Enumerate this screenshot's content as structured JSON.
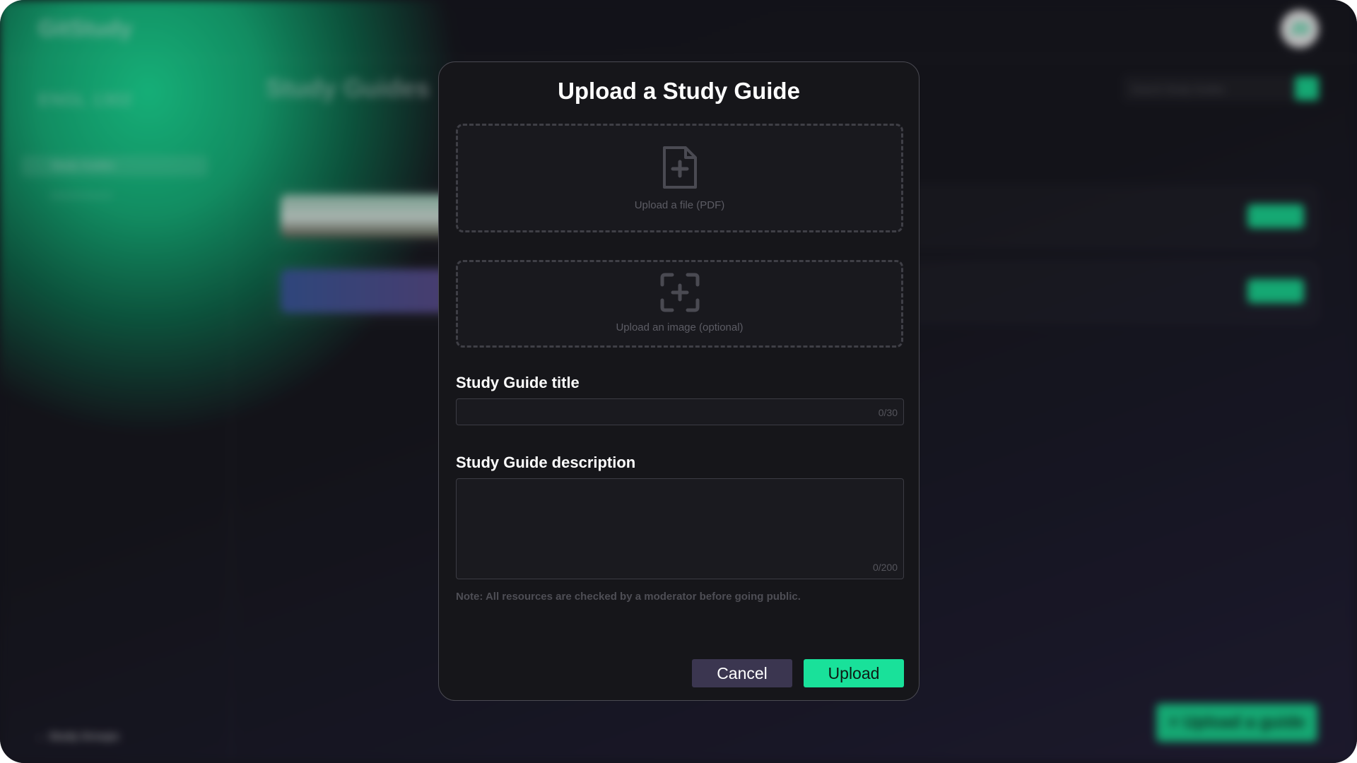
{
  "background": {
    "brand": "GitStudy",
    "course": "ENGL 1302",
    "sidebar_active": "Study Guides",
    "back_link": "Study Groups",
    "avatar_initials": "JD",
    "page_title": "Study Guides",
    "search_placeholder": "Search Study Guides",
    "upload_guide_button": "+ Upload a guide",
    "accent": "#19dc94"
  },
  "modal": {
    "title": "Upload a Study Guide",
    "file_drop_label": "Upload a file (PDF)",
    "image_drop_label": "Upload an image (optional)",
    "title_field": {
      "label": "Study Guide title",
      "value": "",
      "counter": "0/30"
    },
    "description_field": {
      "label": "Study Guide description",
      "value": "",
      "counter": "0/200"
    },
    "note": "Note: All resources are checked by a moderator before going public.",
    "cancel_label": "Cancel",
    "upload_label": "Upload",
    "colors": {
      "upload_button": "#19e19a",
      "cancel_button": "#3b3650",
      "modal_background": "#16161a"
    }
  },
  "icons": {
    "file_drop": "file-plus-icon",
    "image_drop": "image-plus-icon"
  }
}
